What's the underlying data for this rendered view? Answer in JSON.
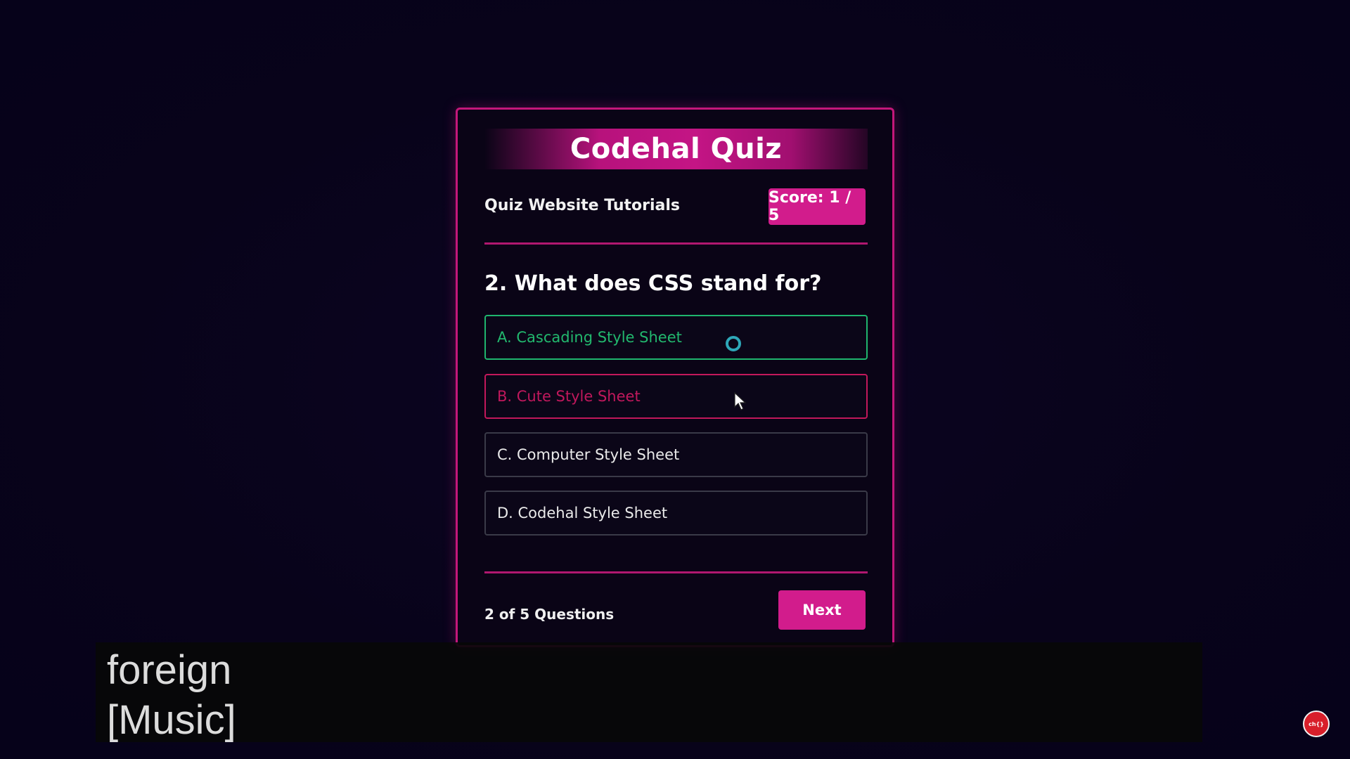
{
  "quiz": {
    "title": "Codehal Quiz",
    "subtitle": "Quiz Website Tutorials",
    "score_label": "Score: 1 / 5",
    "question": "2. What does CSS stand for?",
    "options": [
      {
        "label": "A. Cascading Style Sheet",
        "state": "correct"
      },
      {
        "label": "B. Cute Style Sheet",
        "state": "incorrect"
      },
      {
        "label": "C. Computer Style Sheet",
        "state": "neutral"
      },
      {
        "label": "D. Codehal Style Sheet",
        "state": "neutral"
      }
    ],
    "question_counter": "2 of 5 Questions",
    "next_label": "Next"
  },
  "captions": {
    "line1": "foreign",
    "line2": "[Music]"
  },
  "subscribe_badge": {
    "text": "ch{}"
  },
  "colors": {
    "accent": "#d21c8c",
    "correct": "#22b86e",
    "incorrect": "#c0185c",
    "background": "#08031c"
  },
  "icons": {
    "cursor": "mouse-pointer-icon",
    "loading": "loading-ring-icon"
  }
}
